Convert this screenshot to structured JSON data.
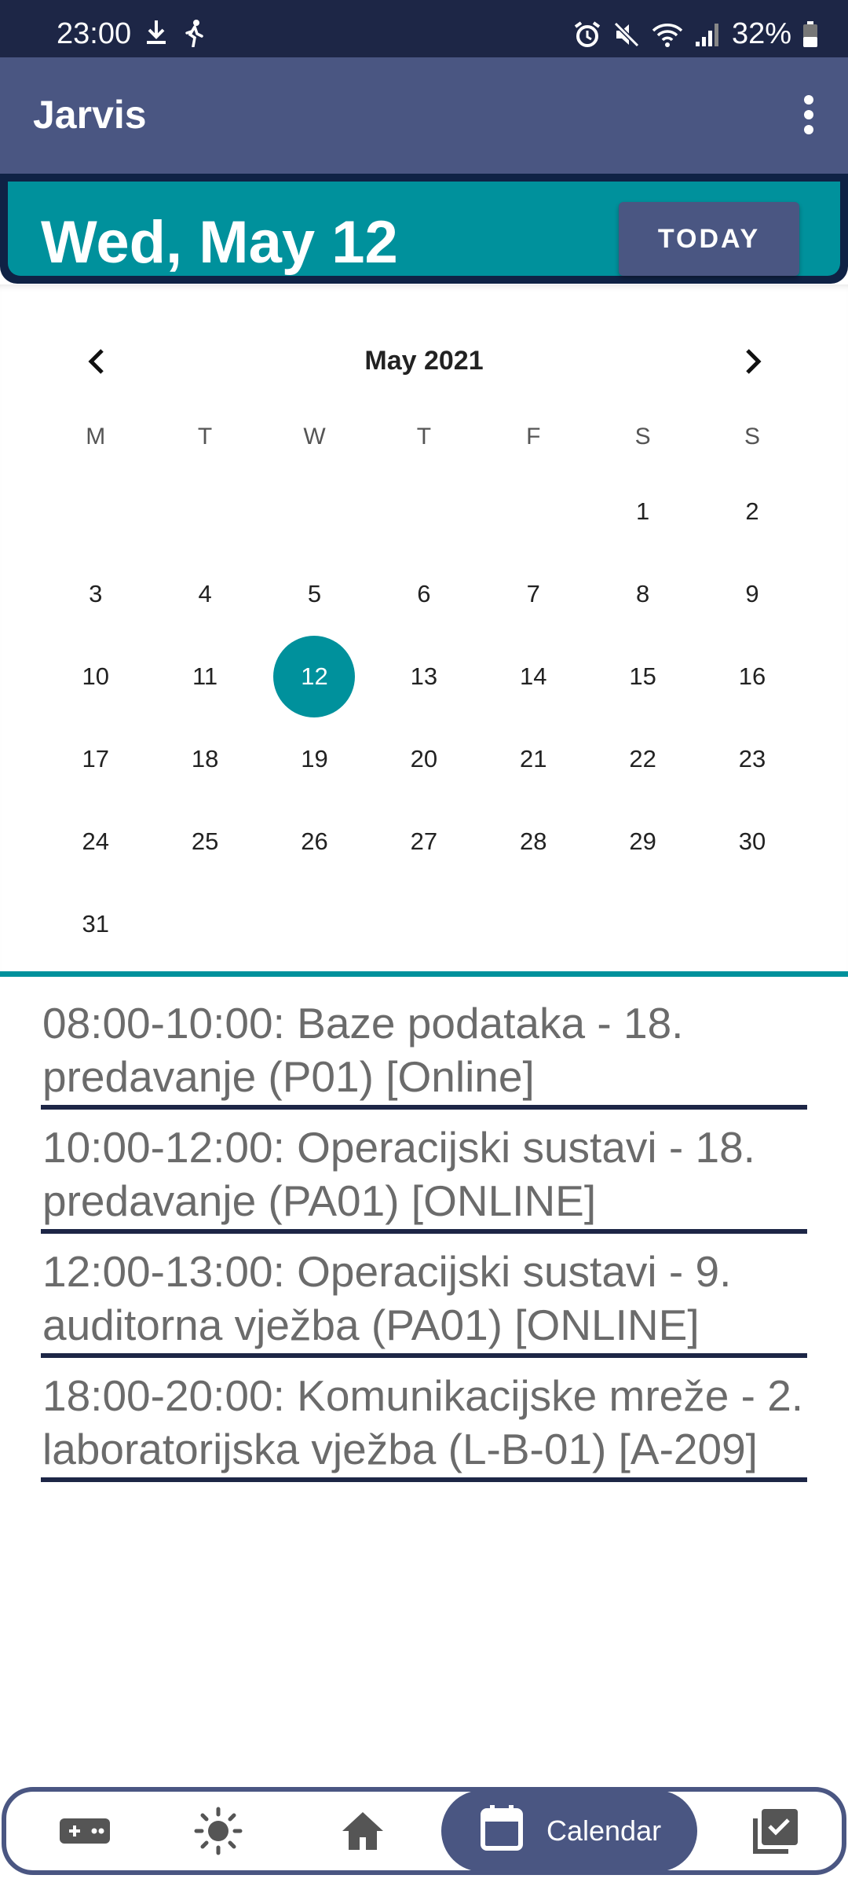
{
  "status_bar": {
    "time": "23:00",
    "left_icons": [
      "download-icon",
      "walking-icon"
    ],
    "right_icons": [
      "alarm-icon",
      "mute-icon",
      "wifi-icon",
      "signal-icon"
    ],
    "battery": "32%"
  },
  "app_bar": {
    "title": "Jarvis",
    "menu_icon": "more-vert-icon"
  },
  "date_header": {
    "date": "Wed, May 12",
    "today_label": "TODAY"
  },
  "calendar": {
    "month_label": "May 2021",
    "weekdays": [
      "M",
      "T",
      "W",
      "T",
      "F",
      "S",
      "S"
    ],
    "leading_blanks": 5,
    "days": [
      "1",
      "2",
      "3",
      "4",
      "5",
      "6",
      "7",
      "8",
      "9",
      "10",
      "11",
      "12",
      "13",
      "14",
      "15",
      "16",
      "17",
      "18",
      "19",
      "20",
      "21",
      "22",
      "23",
      "24",
      "25",
      "26",
      "27",
      "28",
      "29",
      "30",
      "31"
    ],
    "selected_day": "12"
  },
  "events": [
    {
      "text": "08:00-10:00: Baze podataka - 18. predavanje (P01) [Online]"
    },
    {
      "text": "10:00-12:00: Operacijski sustavi - 18. predavanje (PA01) [ONLINE]"
    },
    {
      "text": "12:00-13:00: Operacijski sustavi - 9. auditorna vježba (PA01) [ONLINE]"
    },
    {
      "text": "18:00-20:00: Komunikacijske mreže - 2. laboratorijska vježba (L-B-01) [A-209]"
    }
  ],
  "bottom_nav": {
    "items": [
      {
        "icon": "gamepad-icon"
      },
      {
        "icon": "sun-icon"
      },
      {
        "icon": "home-icon"
      },
      {
        "icon": "calendar-icon",
        "label": "Calendar",
        "active": true
      },
      {
        "icon": "checklist-icon"
      }
    ]
  },
  "colors": {
    "status_bar": "#1d2646",
    "app_bar": "#4a5682",
    "accent": "#00919c",
    "event_text": "#6b6b6b"
  }
}
